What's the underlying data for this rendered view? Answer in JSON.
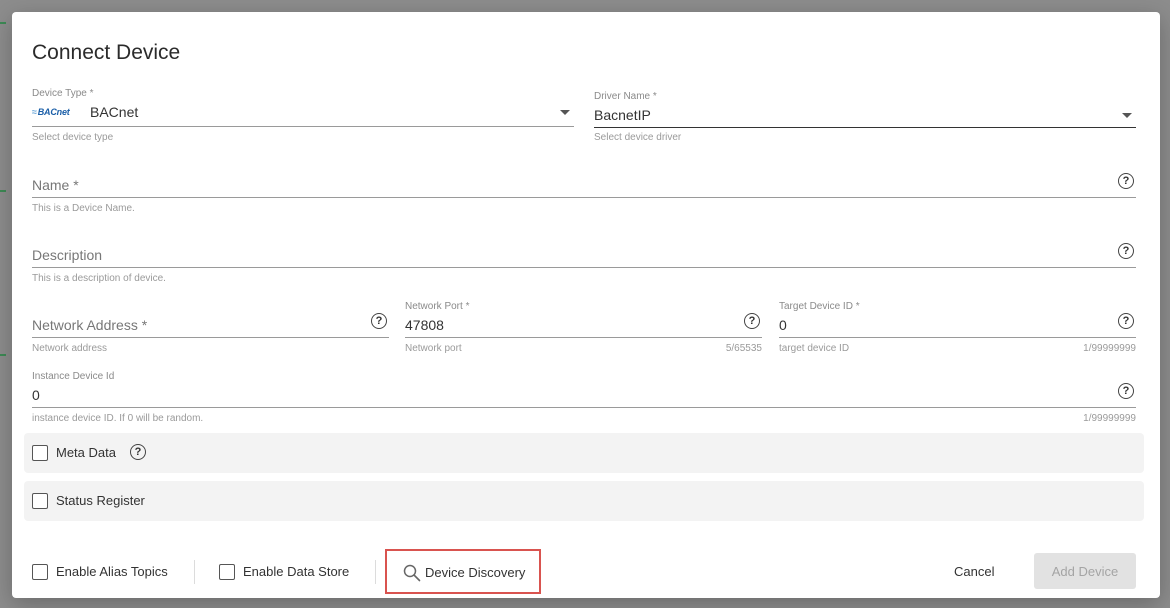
{
  "dialog": {
    "title": "Connect Device"
  },
  "device_type": {
    "label": "Device Type *",
    "value": "BACnet",
    "logo_text": "BACnet",
    "hint": "Select device type"
  },
  "driver_name": {
    "label": "Driver Name *",
    "value": "BacnetIP",
    "hint": "Select device driver"
  },
  "name": {
    "placeholder": "Name *",
    "hint": "This is a Device Name."
  },
  "description": {
    "placeholder": "Description",
    "hint": "This is a description of device."
  },
  "network_address": {
    "placeholder": "Network Address *",
    "hint": "Network address"
  },
  "network_port": {
    "label": "Network Port *",
    "value": "47808",
    "hint": "Network port",
    "counter": "5/65535"
  },
  "target_device_id": {
    "label": "Target Device ID *",
    "value": "0",
    "hint": "target device ID",
    "counter": "1/99999999"
  },
  "instance_device_id": {
    "label": "Instance Device Id",
    "value": "0",
    "hint": "instance device ID. If 0 will be random.",
    "counter": "1/99999999"
  },
  "help_glyph": "?",
  "meta_data": {
    "label": "Meta Data",
    "checked": false
  },
  "status_register": {
    "label": "Status Register",
    "checked": false
  },
  "footer": {
    "enable_alias_topics": "Enable Alias Topics",
    "enable_data_store": "Enable Data Store",
    "device_discovery": "Device Discovery",
    "cancel": "Cancel",
    "add_device": "Add Device"
  },
  "colors": {
    "highlight_border": "#d9534f",
    "disabled_button_bg": "#e2e2e2",
    "disabled_button_text": "#a4a4a4",
    "panel_bg": "#f3f3f3"
  },
  "icons": [
    "chevron-down-icon",
    "help-icon",
    "search-icon",
    "checkbox-icon",
    "bacnet-logo"
  ]
}
